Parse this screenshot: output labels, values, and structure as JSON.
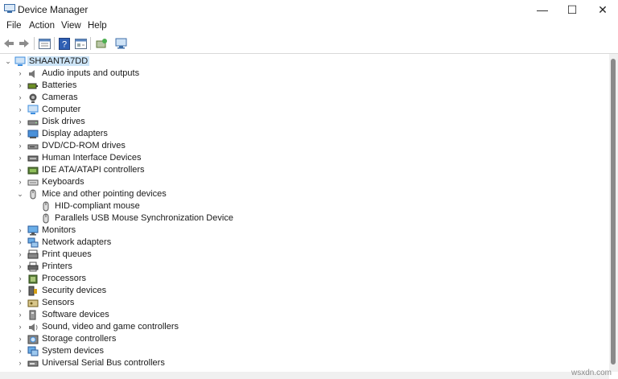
{
  "window": {
    "title": "Device Manager",
    "minimize": "—",
    "maximize": "☐",
    "close": "✕"
  },
  "menu": [
    "File",
    "Action",
    "View",
    "Help"
  ],
  "toolbar": [
    "back-icon",
    "forward-icon",
    "properties-view-icon",
    "help-icon",
    "device-view-icon",
    "update-driver-icon",
    "monitor-scan-icon"
  ],
  "tree": {
    "root": "SHAANTA7DD",
    "items": [
      {
        "label": "Audio inputs and outputs",
        "icon": "speaker-icon"
      },
      {
        "label": "Batteries",
        "icon": "battery-icon"
      },
      {
        "label": "Cameras",
        "icon": "camera-icon"
      },
      {
        "label": "Computer",
        "icon": "computer-icon"
      },
      {
        "label": "Disk drives",
        "icon": "disk-icon"
      },
      {
        "label": "Display adapters",
        "icon": "display-icon"
      },
      {
        "label": "DVD/CD-ROM drives",
        "icon": "dvd-icon"
      },
      {
        "label": "Human Interface Devices",
        "icon": "hid-icon"
      },
      {
        "label": "IDE ATA/ATAPI controllers",
        "icon": "ide-icon"
      },
      {
        "label": "Keyboards",
        "icon": "keyboard-icon"
      },
      {
        "label": "Mice and other pointing devices",
        "icon": "mouse-icon",
        "expanded": true,
        "children": [
          "HID-compliant mouse",
          "Parallels USB Mouse Synchronization Device"
        ]
      },
      {
        "label": "Monitors",
        "icon": "monitor-icon"
      },
      {
        "label": "Network adapters",
        "icon": "network-icon"
      },
      {
        "label": "Print queues",
        "icon": "print-queue-icon"
      },
      {
        "label": "Printers",
        "icon": "printer-icon"
      },
      {
        "label": "Processors",
        "icon": "processor-icon"
      },
      {
        "label": "Security devices",
        "icon": "security-icon"
      },
      {
        "label": "Sensors",
        "icon": "sensor-icon"
      },
      {
        "label": "Software devices",
        "icon": "software-icon"
      },
      {
        "label": "Sound, video and game controllers",
        "icon": "sound-icon"
      },
      {
        "label": "Storage controllers",
        "icon": "storage-icon"
      },
      {
        "label": "System devices",
        "icon": "system-icon"
      },
      {
        "label": "Universal Serial Bus controllers",
        "icon": "usb-icon"
      }
    ]
  },
  "watermark": "wsxdn.com",
  "colors": {
    "selection": "#cce4f7",
    "icon_blue": "#3c8dde"
  }
}
